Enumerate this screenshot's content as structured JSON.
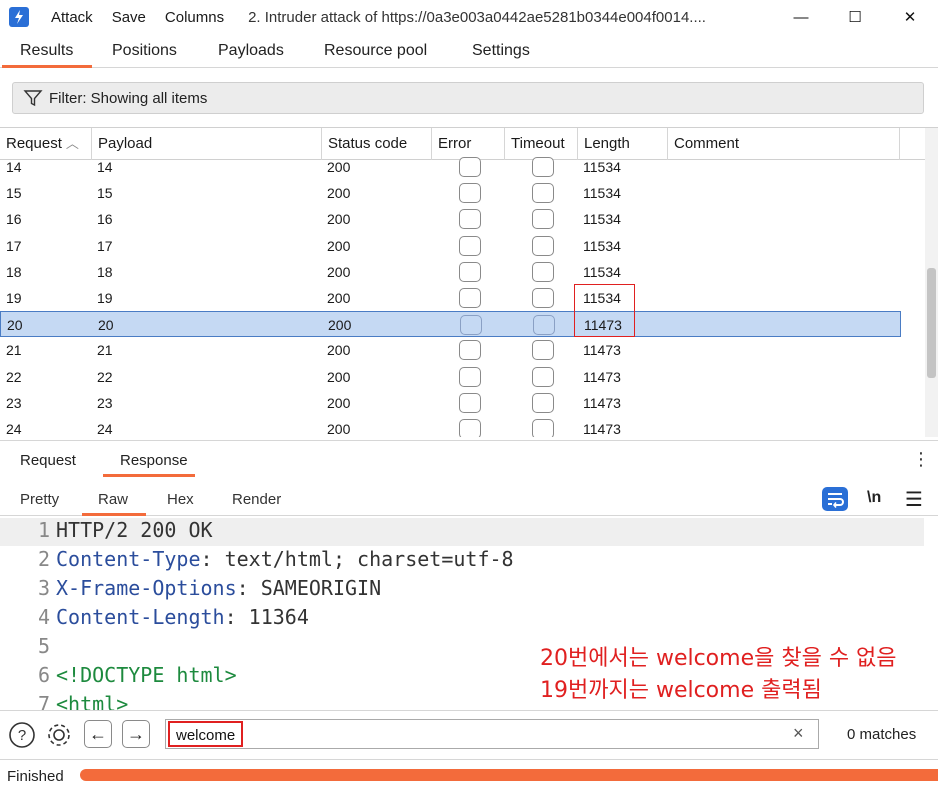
{
  "titlebar": {
    "menu": [
      "Attack",
      "Save",
      "Columns"
    ],
    "title": "2. Intruder attack of https://0a3e003a0442ae5281b0344e004f0014....",
    "minimize": "—",
    "maximize": "☐",
    "close": "✕"
  },
  "top_tabs": [
    "Results",
    "Positions",
    "Payloads",
    "Resource pool",
    "Settings"
  ],
  "active_top_tab": "Results",
  "filter": {
    "text": "Filter: Showing all items"
  },
  "table": {
    "columns": [
      "Request",
      "Payload",
      "Status code",
      "Error",
      "Timeout",
      "Length",
      "Comment"
    ],
    "sort_indicator": "^",
    "rows": [
      {
        "request": "14",
        "payload": "14",
        "status": "200",
        "length": "11534"
      },
      {
        "request": "15",
        "payload": "15",
        "status": "200",
        "length": "11534"
      },
      {
        "request": "16",
        "payload": "16",
        "status": "200",
        "length": "11534"
      },
      {
        "request": "17",
        "payload": "17",
        "status": "200",
        "length": "11534"
      },
      {
        "request": "18",
        "payload": "18",
        "status": "200",
        "length": "11534"
      },
      {
        "request": "19",
        "payload": "19",
        "status": "200",
        "length": "11534"
      },
      {
        "request": "20",
        "payload": "20",
        "status": "200",
        "length": "11473"
      },
      {
        "request": "21",
        "payload": "21",
        "status": "200",
        "length": "11473"
      },
      {
        "request": "22",
        "payload": "22",
        "status": "200",
        "length": "11473"
      },
      {
        "request": "23",
        "payload": "23",
        "status": "200",
        "length": "11473"
      },
      {
        "request": "24",
        "payload": "24",
        "status": "200",
        "length": "11473"
      }
    ],
    "selected_request": "20"
  },
  "rr_tabs": [
    "Request",
    "Response"
  ],
  "active_rr_tab": "Response",
  "view_tabs": [
    "Pretty",
    "Raw",
    "Hex",
    "Render"
  ],
  "active_view_tab": "Raw",
  "view_tools": {
    "newline": "\\n",
    "menu": "☰",
    "more": "⋮"
  },
  "code_lines": [
    {
      "n": "1",
      "key": "HTTP/2 200 OK",
      "sep": "",
      "val": ""
    },
    {
      "n": "2",
      "key": "Content-Type",
      "sep": ":",
      "val": " text/html; charset=utf-8"
    },
    {
      "n": "3",
      "key": "X-Frame-Options",
      "sep": ":",
      "val": " SAMEORIGIN"
    },
    {
      "n": "4",
      "key": "Content-Length",
      "sep": ":",
      "val": " 11364"
    },
    {
      "n": "5",
      "key": "",
      "sep": "",
      "val": ""
    },
    {
      "n": "6",
      "key": "<!DOCTYPE html>",
      "sep": "",
      "val": ""
    },
    {
      "n": "7",
      "key": "<html>",
      "sep": "",
      "val": ""
    }
  ],
  "annotation": {
    "line1": "20번에서는 welcome을 찾을 수 없음",
    "line2": "19번까지는 welcome 출력됨"
  },
  "search": {
    "value": "welcome",
    "clear": "×",
    "matches": "0 matches"
  },
  "status": {
    "text": "Finished",
    "progress": 1.0
  },
  "colors": {
    "accent": "#f36b3b",
    "selection": "#c5d9f3",
    "highlight_red": "#e02020",
    "code_key": "#2b4d9c",
    "code_tag": "#1d8a3e"
  }
}
